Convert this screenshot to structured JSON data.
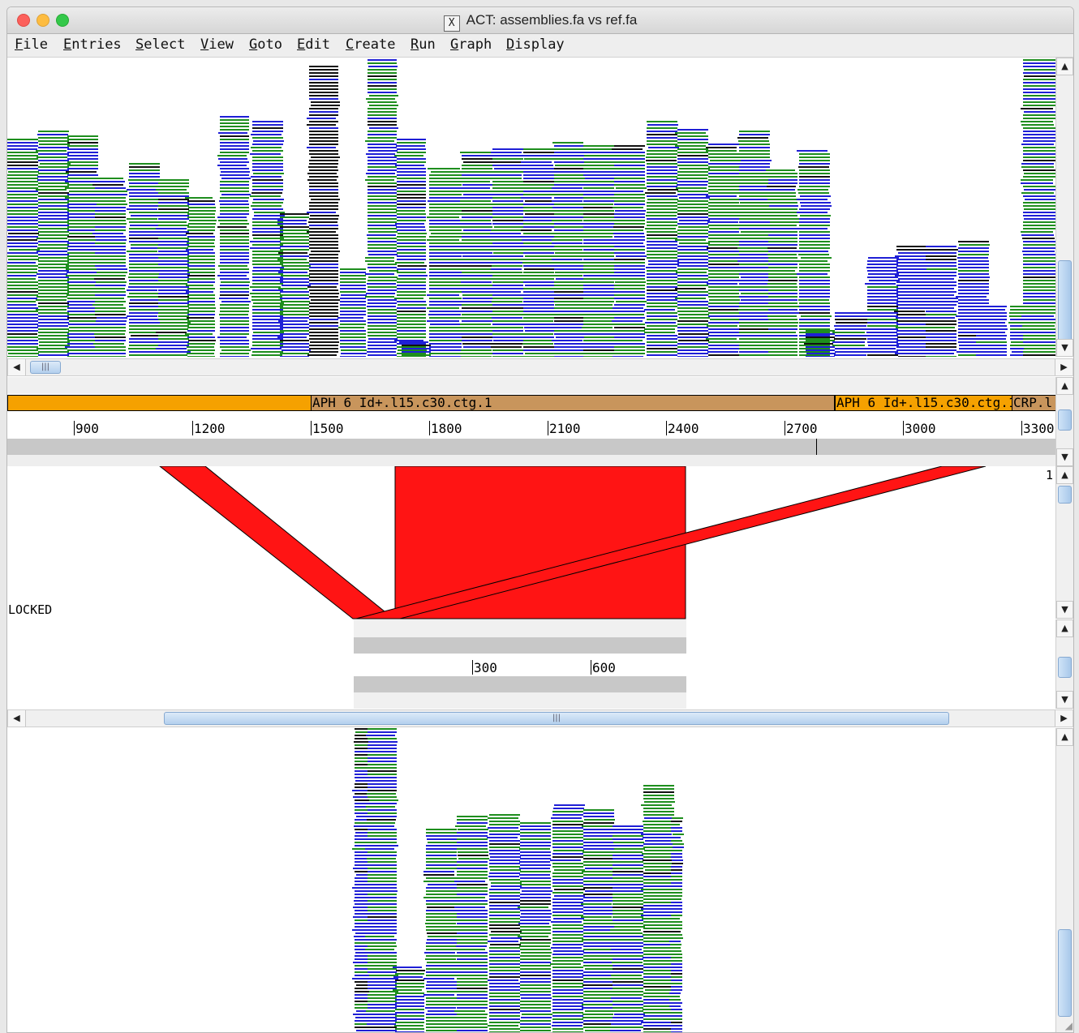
{
  "window": {
    "title": "ACT: assemblies.fa vs ref.fa",
    "x11_glyph": "X"
  },
  "menu": {
    "items": [
      "File",
      "Entries",
      "Select",
      "View",
      "Goto",
      "Edit",
      "Create",
      "Run",
      "Graph",
      "Display"
    ]
  },
  "top_ruler": {
    "ticks": [
      "900",
      "1200",
      "1500",
      "1800",
      "2100",
      "2400",
      "2700",
      "3000",
      "3300"
    ]
  },
  "top_features": {
    "feature1": "APH 6  Id+.l15.c30.ctg.1",
    "feature2": "APH 6  Id+.l15.c30.ctg.1",
    "feature3": "CRP.l"
  },
  "comparison": {
    "locked_label": "LOCKED",
    "score_label": "1"
  },
  "bottom_ruler": {
    "ticks": [
      "300",
      "600"
    ]
  },
  "colors": {
    "read_green": "#1e8e1e",
    "read_blue": "#1f1fd6",
    "read_black": "#111111",
    "match_red": "#ff1414",
    "feature_orange": "#f5a100",
    "feature_tan": "#c8955c"
  },
  "icons": {
    "scroll_up": "triangle-up-icon",
    "scroll_down": "triangle-down-icon",
    "scroll_left": "triangle-left-icon",
    "scroll_right": "triangle-right-icon",
    "resize": "resize-grip-icon"
  }
}
